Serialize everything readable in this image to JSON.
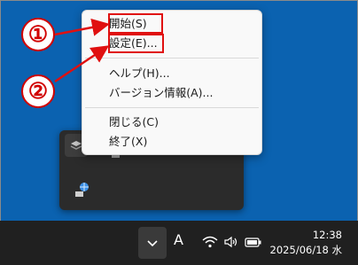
{
  "context_menu": {
    "items": [
      {
        "label": "開始(S)"
      },
      {
        "label": "設定(E)..."
      },
      {
        "label": "ヘルプ(H)..."
      },
      {
        "label": "バージョン情報(A)..."
      },
      {
        "label": "閉じる(C)"
      },
      {
        "label": "終了(X)"
      }
    ]
  },
  "callouts": {
    "one": "①",
    "two": "②"
  },
  "taskbar": {
    "ime_indicator": "A",
    "time": "12:38",
    "date": "2025/06/18 水"
  },
  "colors": {
    "desktop": "#0b62b0",
    "highlight": "#e01010",
    "taskbar": "#202020"
  }
}
